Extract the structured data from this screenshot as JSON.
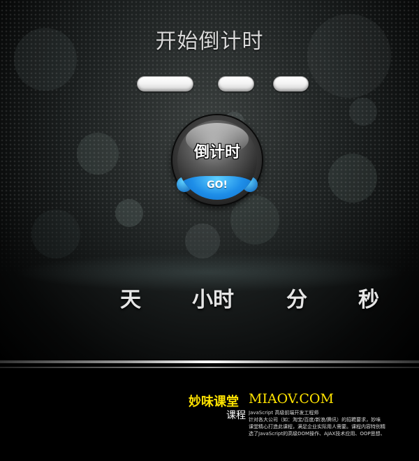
{
  "title": "开始倒计时",
  "inputs": [
    {
      "value": ""
    },
    {
      "value": ""
    },
    {
      "value": ""
    }
  ],
  "button": {
    "label": "倒计时",
    "go_label": "GO!"
  },
  "units": [
    "天",
    "小时",
    "分",
    "秒"
  ],
  "footer": {
    "brand": "妙味课堂",
    "url": "MIAOV.COM",
    "course_label": "课程",
    "lines": [
      "JavaScript 高级前端开发工程师",
      "针对各大公司（如：淘宝/百度/新浪/腾讯）的招聘要求，妙味",
      "课堂精心打造此课程，满足企业实际用人需要。课程内容特别精",
      "选了JavaScript的高级DOM操作、AJAX技术应用、OOP思想、"
    ]
  },
  "colors": {
    "brand": "#ffe300",
    "go_button": "#1e8ee8",
    "background": "#000000"
  }
}
